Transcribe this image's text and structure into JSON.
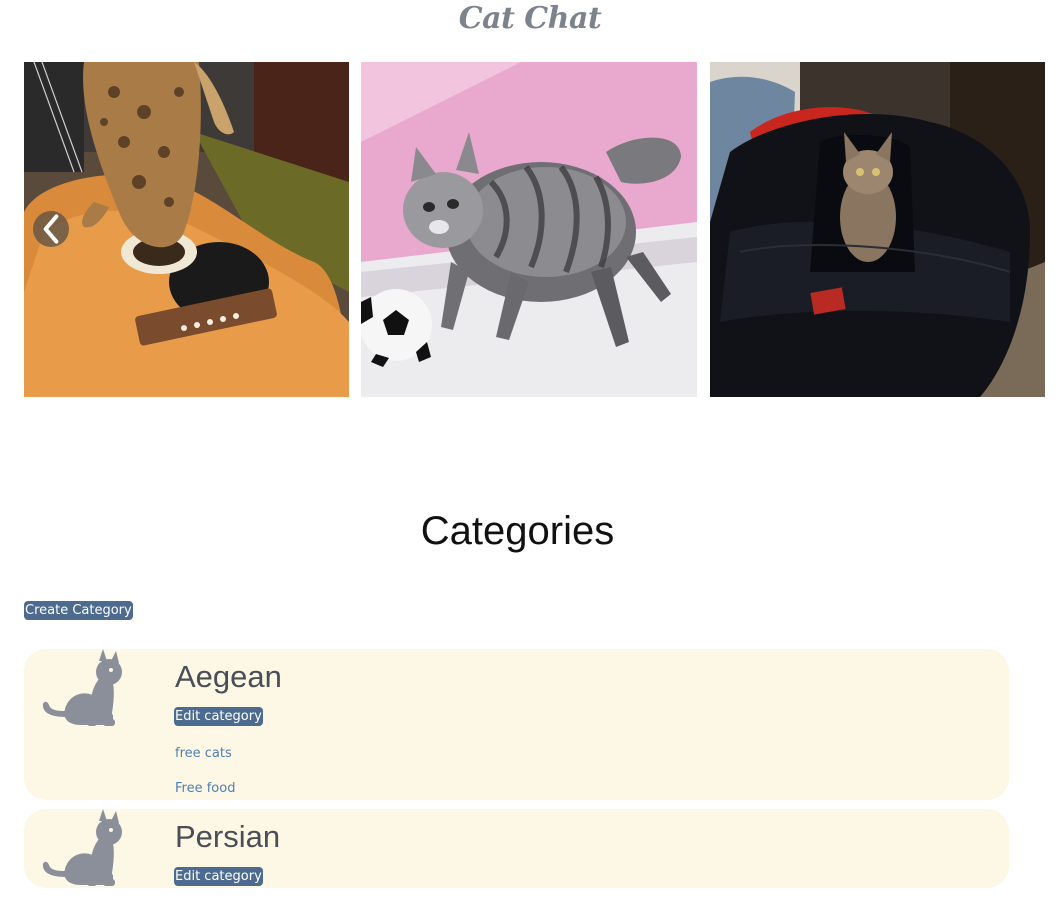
{
  "site": {
    "title": "Cat Chat"
  },
  "carousel": {
    "slides": [
      {
        "alt": "cat-on-guitar"
      },
      {
        "alt": "kitten-with-soccer-ball"
      },
      {
        "alt": "kitten-in-bag"
      }
    ],
    "prev_icon": "chevron-left-icon"
  },
  "categories": {
    "heading": "Categories",
    "create_label": "Create Category",
    "items": [
      {
        "name": "Aegean",
        "edit_label": "Edit category",
        "subitems": [
          "free cats",
          "Free food"
        ]
      },
      {
        "name": "Persian",
        "edit_label": "Edit category",
        "subitems": []
      }
    ]
  },
  "colors": {
    "accent": "#4d6b8e",
    "card_bg": "#fdf8e6",
    "link": "#4f7fb0",
    "icon": "#8a8f99"
  }
}
